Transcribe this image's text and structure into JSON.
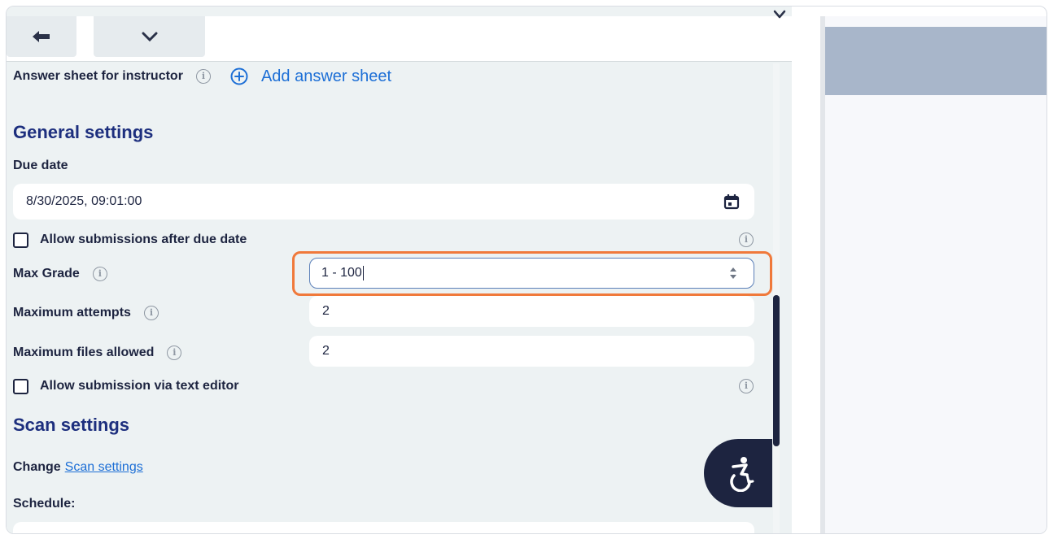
{
  "answer_sheet": {
    "label": "Answer sheet for instructor",
    "add_label": "Add answer sheet"
  },
  "general": {
    "heading": "General settings",
    "due_date_label": "Due date",
    "due_date_value": "8/30/2025, 09:01:00",
    "allow_late_label": "Allow submissions after due date",
    "max_grade_label": "Max Grade",
    "max_grade_value": "1 - 100",
    "max_attempts_label": "Maximum attempts",
    "max_attempts_value": "2",
    "max_files_label": "Maximum files allowed",
    "max_files_value": "2",
    "text_editor_label": "Allow submission via text editor"
  },
  "scan": {
    "heading": "Scan settings",
    "change_label": "Change",
    "link_label": "Scan settings",
    "schedule_label": "Schedule:"
  },
  "icons": {
    "back": "arrow-left-icon",
    "more": "chevron-down-icon",
    "close": "close-icon",
    "info": "info-icon",
    "add": "plus-circle-icon",
    "calendar": "calendar-icon",
    "stepper": "stepper-icon",
    "accessibility": "accessibility-icon"
  },
  "colors": {
    "heading": "#1d2f7e",
    "link": "#1d6fd6",
    "highlight": "#f0793b",
    "panel_bg": "#edf2f3"
  }
}
